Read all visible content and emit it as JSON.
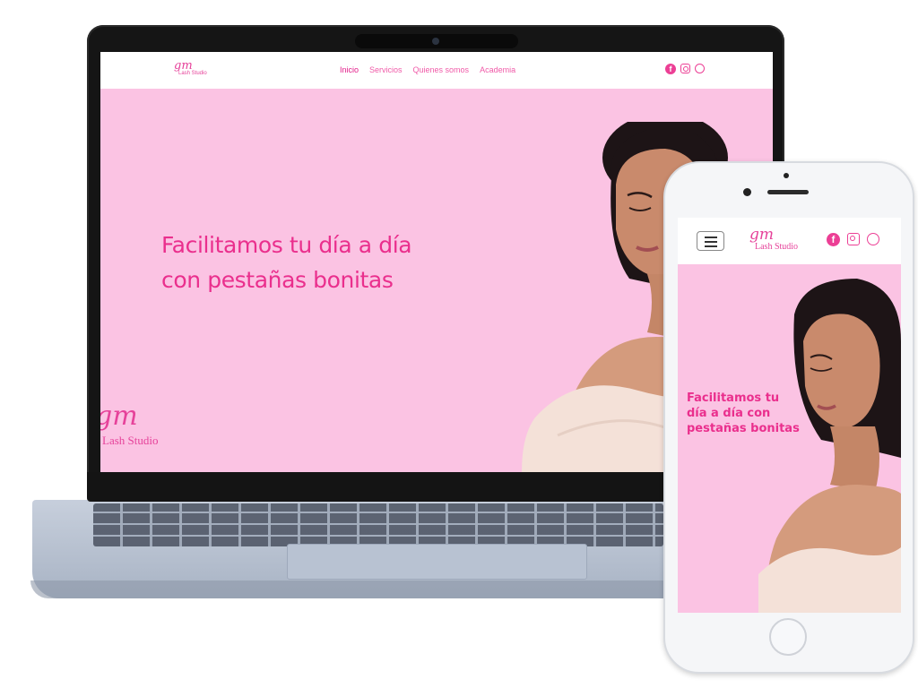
{
  "laptop": {
    "nav": {
      "logo_mark": "gm",
      "logo_text": "Lash Studio",
      "menu": [
        {
          "label": "Inicio",
          "active": true
        },
        {
          "label": "Servicios"
        },
        {
          "label": "Quienes somos"
        },
        {
          "label": "Academia"
        }
      ],
      "social_icons": [
        "facebook-icon",
        "instagram-icon",
        "whatsapp-icon"
      ]
    },
    "hero": {
      "headline_line1": "Facilitamos tu día a día",
      "headline_line2": "con pestañas bonitas",
      "logo_mark": "gm",
      "logo_text": "Lash Studio"
    }
  },
  "phone": {
    "nav": {
      "logo_mark": "gm",
      "logo_text": "Lash Studio",
      "social_icons": [
        "facebook-icon",
        "instagram-icon",
        "whatsapp-icon"
      ]
    },
    "hero": {
      "headline_line1": "Facilitamos tu",
      "headline_line2": "día a día con",
      "headline_line3": "pestañas bonitas"
    }
  },
  "colors": {
    "hero_background": "#fbc3e3",
    "accent_pink": "#ea2f8d",
    "nav_background": "#ffffff"
  }
}
